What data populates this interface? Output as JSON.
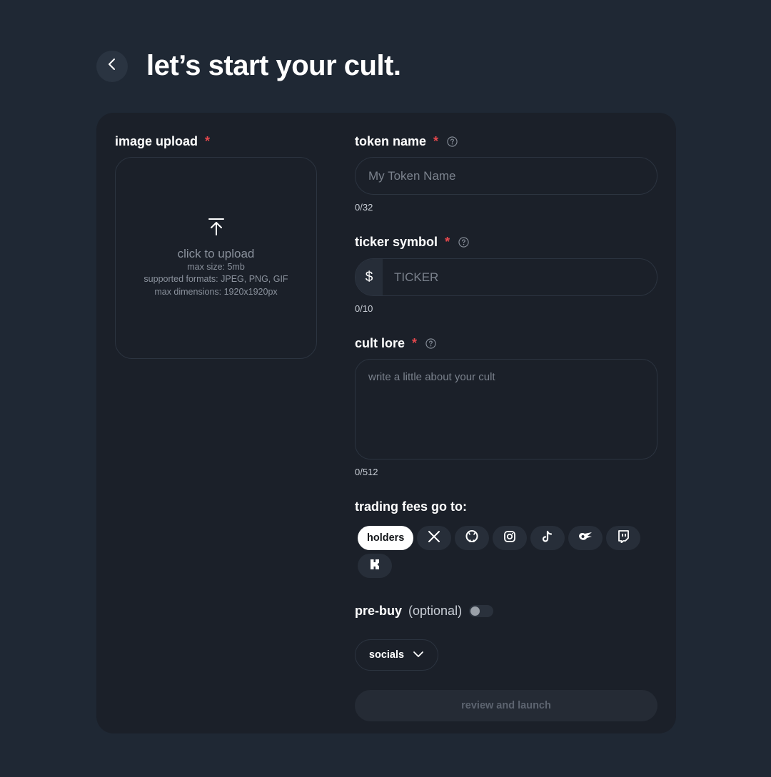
{
  "header": {
    "title": "let’s start your cult."
  },
  "upload": {
    "label": "image upload",
    "required_mark": "*",
    "main_text": "click to upload",
    "max_size": "max size: 5mb",
    "formats": "supported formats: JPEG, PNG, GIF",
    "dimensions": "max dimensions: 1920x1920px"
  },
  "token_name": {
    "label": "token name",
    "required_mark": "*",
    "placeholder": "My Token Name",
    "counter": "0/32"
  },
  "ticker": {
    "label": "ticker symbol",
    "required_mark": "*",
    "prefix": "$",
    "placeholder": "TICKER",
    "counter": "0/10"
  },
  "lore": {
    "label": "cult lore",
    "required_mark": "*",
    "placeholder": "write a little about your cult",
    "counter": "0/512"
  },
  "fees": {
    "label": "trading fees go to:",
    "selected": "holders",
    "options": [
      "holders",
      "x-icon",
      "github-icon",
      "instagram-icon",
      "tiktok-icon",
      "wings-icon",
      "twitch-icon",
      "kick-icon"
    ]
  },
  "prebuy": {
    "label": "pre-buy",
    "optional": "(optional)",
    "enabled": false
  },
  "socials": {
    "label": "socials"
  },
  "launch": {
    "label": "review and launch"
  },
  "colors": {
    "background": "#1f2834",
    "card": "#1b2029",
    "required": "#e5484d",
    "active_chip": "#ffffff"
  }
}
